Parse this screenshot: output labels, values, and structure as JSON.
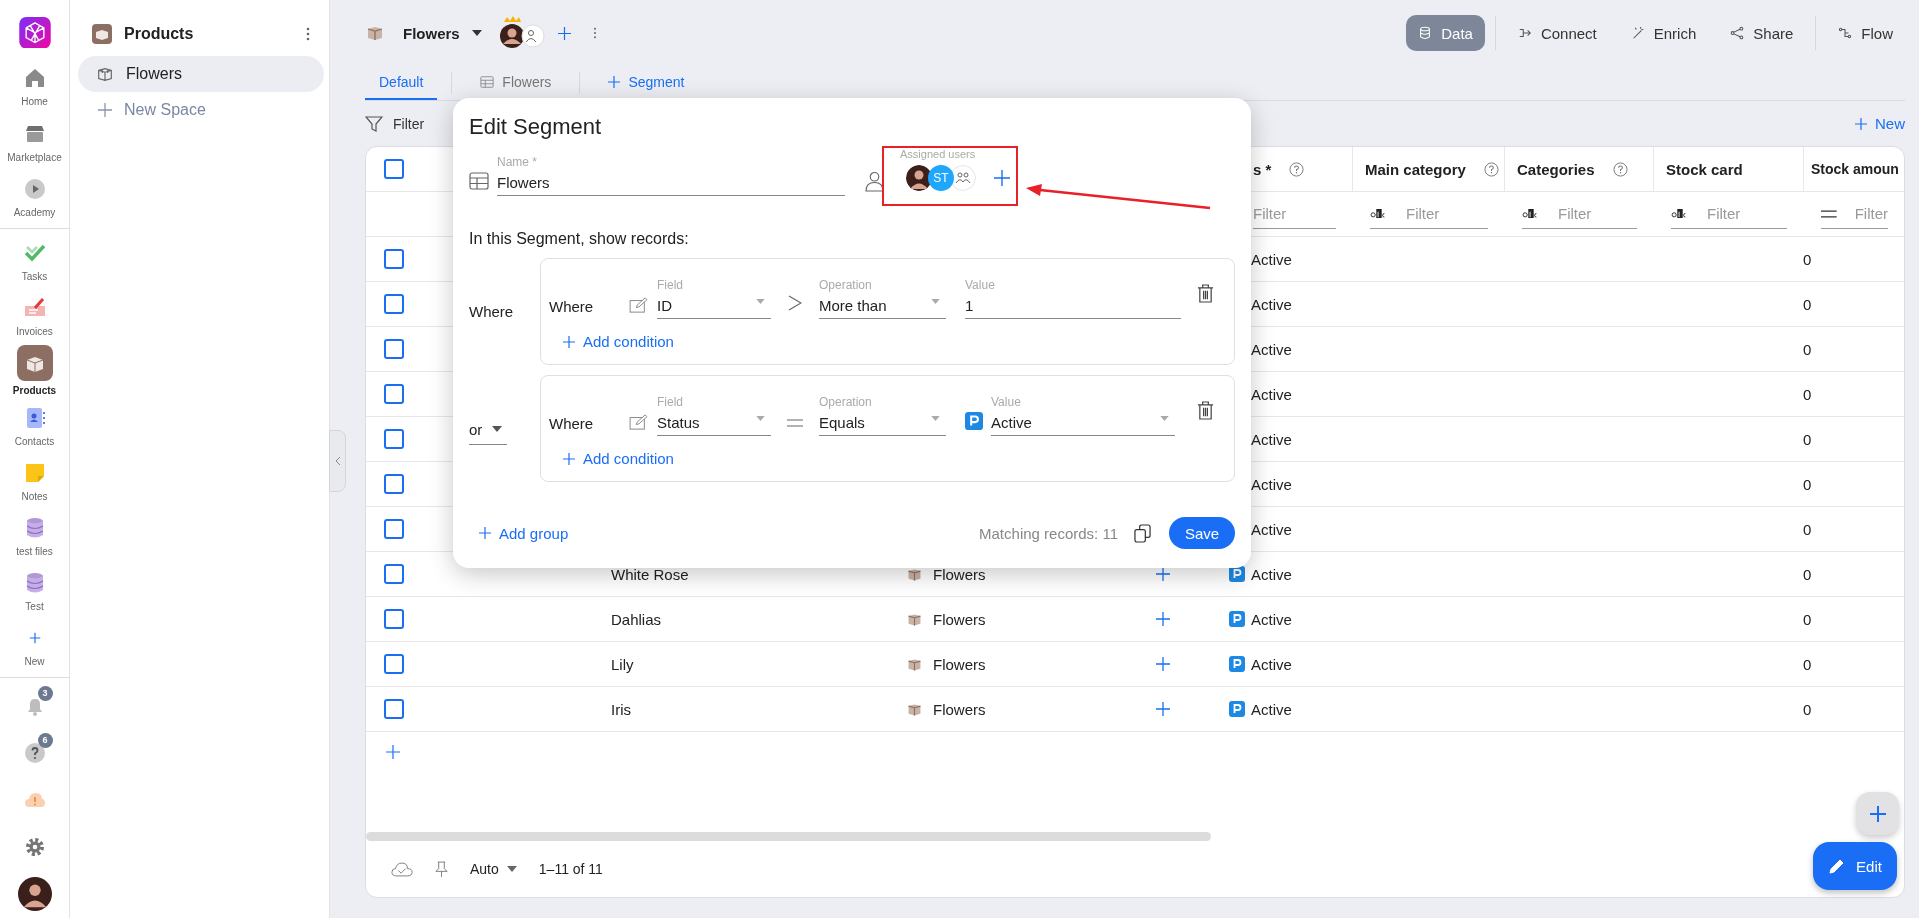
{
  "rail": {
    "top_items": [
      {
        "kind": "home",
        "label": "Home",
        "selected": false
      },
      {
        "kind": "store",
        "label": "Marketplace",
        "selected": false
      },
      {
        "kind": "play",
        "label": "Academy",
        "selected": false
      }
    ],
    "items": [
      {
        "kind": "check",
        "label": "Tasks",
        "selected": false
      },
      {
        "kind": "invoice",
        "label": "Invoices",
        "selected": false
      },
      {
        "kind": "box",
        "label": "Products",
        "selected": true
      },
      {
        "kind": "contacts",
        "label": "Contacts",
        "selected": false
      },
      {
        "kind": "note",
        "label": "Notes",
        "selected": false
      },
      {
        "kind": "database",
        "label": "test files",
        "selected": false
      },
      {
        "kind": "database",
        "label": "Test",
        "selected": false
      },
      {
        "kind": "add",
        "label": "New",
        "selected": false
      }
    ],
    "bottom": [
      {
        "kind": "bell",
        "badge": "3"
      },
      {
        "kind": "help",
        "badge": "6"
      },
      {
        "kind": "cloud"
      },
      {
        "kind": "gear"
      },
      {
        "kind": "avatar"
      }
    ]
  },
  "sidebar": {
    "title": "Products",
    "spaces": [
      {
        "label": "Flowers",
        "selected": true
      }
    ],
    "new_space": "New Space"
  },
  "header": {
    "space": "Flowers",
    "actions": [
      {
        "kind": "data",
        "label": "Data",
        "selected": true
      },
      {
        "kind": "connect",
        "label": "Connect",
        "selected": false
      },
      {
        "kind": "enrich",
        "label": "Enrich",
        "selected": false
      },
      {
        "kind": "share",
        "label": "Share",
        "selected": false
      },
      {
        "kind": "flow",
        "label": "Flow",
        "selected": false
      }
    ]
  },
  "tabs": [
    {
      "kind": "plain",
      "label": "Default",
      "selected": true
    },
    {
      "kind": "table",
      "label": "Flowers",
      "selected": false
    }
  ],
  "add_segment": "Segment",
  "toolbar": {
    "filter": "Filter",
    "new": "New"
  },
  "table": {
    "header_checked": false,
    "columns": [
      {
        "label": "s *",
        "help": true
      },
      {
        "label": "Main category",
        "help": true
      },
      {
        "label": "Categories",
        "help": true
      },
      {
        "label": "Stock card",
        "help": false
      },
      {
        "label": "Stock amoun",
        "help": false
      }
    ],
    "filters": [
      {
        "kind": "plain",
        "placeholder": "Filter"
      },
      {
        "kind": "text",
        "placeholder": "Filter"
      },
      {
        "kind": "text",
        "placeholder": "Filter"
      },
      {
        "kind": "text",
        "placeholder": "Filter"
      },
      {
        "kind": "number",
        "placeholder": "Filter"
      }
    ],
    "rows": [
      {
        "checked": false,
        "status": "Active",
        "amount": "0"
      },
      {
        "checked": false,
        "status": "Active",
        "amount": "0"
      },
      {
        "checked": false,
        "status": "Active",
        "amount": "0"
      },
      {
        "checked": false,
        "status": "Active",
        "amount": "0"
      },
      {
        "checked": false,
        "status": "Active",
        "amount": "0"
      },
      {
        "checked": false,
        "status": "Active",
        "amount": "0"
      },
      {
        "checked": false,
        "status": "Active",
        "amount": "0"
      },
      {
        "checked": false,
        "name": "White Rose",
        "space": "Flowers",
        "status": "Active",
        "amount": "0"
      },
      {
        "checked": false,
        "name": "Dahlias",
        "space": "Flowers",
        "status": "Active",
        "amount": "0"
      },
      {
        "checked": false,
        "name": "Lily",
        "space": "Flowers",
        "status": "Active",
        "amount": "0"
      },
      {
        "checked": false,
        "name": "Iris",
        "space": "Flowers",
        "status": "Active",
        "amount": "0"
      }
    ]
  },
  "footer": {
    "density": "Auto",
    "range": "1–11 of 11"
  },
  "edit_button": "Edit",
  "modal": {
    "title": "Edit Segment",
    "name_label": "Name *",
    "name": "Flowers",
    "assigned_label": "Assigned users",
    "assignees": [
      {
        "kind": "photo"
      },
      {
        "kind": "initials",
        "initials": "ST"
      },
      {
        "kind": "group"
      }
    ],
    "intro": "In this Segment, show records:",
    "groups": [
      {
        "connector": "Where",
        "kind": "label",
        "add_condition": "Add condition",
        "conditions": [
          {
            "where": "Where",
            "field_label": "Field",
            "field": "ID",
            "operation": {
              "kind": "more",
              "label": "Operation",
              "text": "More than"
            },
            "value": {
              "kind": "text",
              "label": "Value",
              "text": "1"
            }
          }
        ]
      },
      {
        "connector": "or",
        "kind": "dropdown",
        "add_condition": "Add condition",
        "conditions": [
          {
            "where": "Where",
            "field_label": "Field",
            "field": "Status",
            "operation": {
              "kind": "equals",
              "label": "Operation",
              "text": "Equals"
            },
            "value": {
              "kind": "status",
              "label": "Value",
              "text": "Active"
            }
          }
        ]
      }
    ],
    "add_group": "Add group",
    "matching": "Matching records: 11",
    "save": "Save"
  }
}
